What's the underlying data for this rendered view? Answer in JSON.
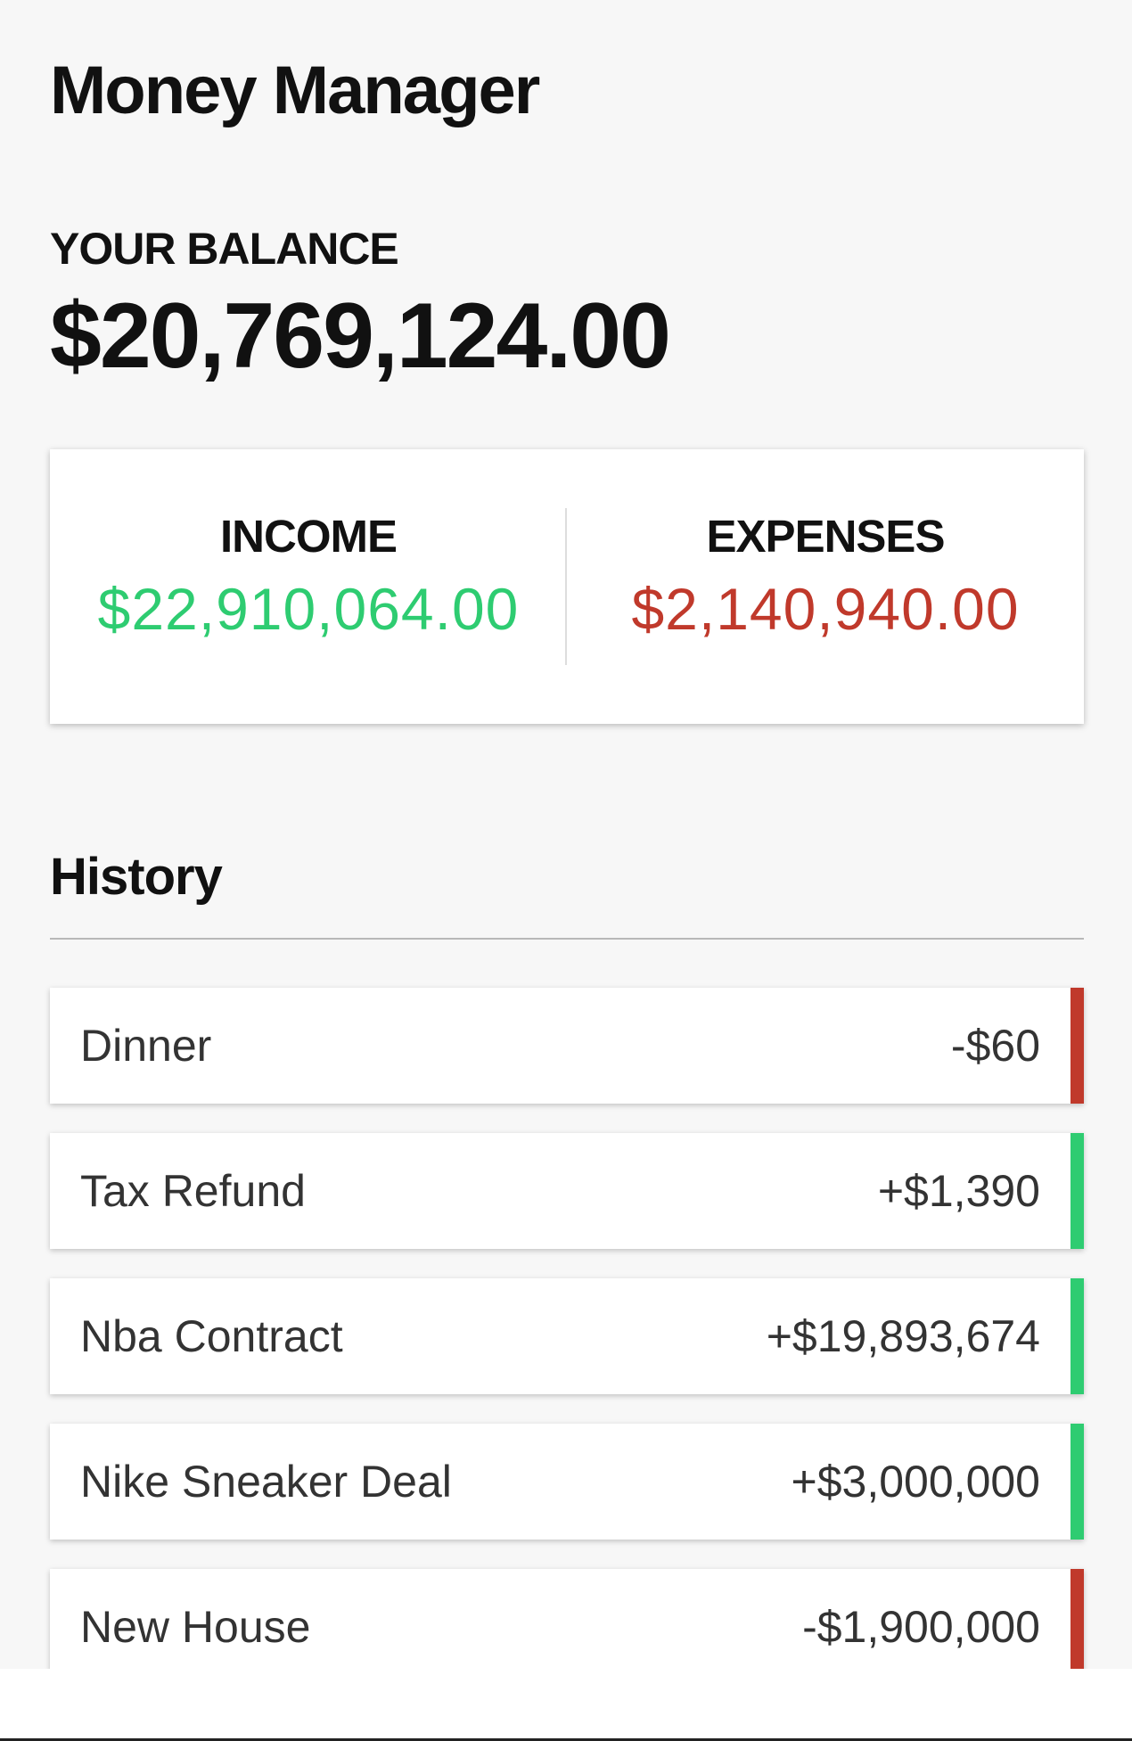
{
  "app": {
    "title": "Money Manager"
  },
  "balance": {
    "label": "YOUR BALANCE",
    "value": "$20,769,124.00"
  },
  "summary": {
    "income_label": "INCOME",
    "income_value": "$22,910,064.00",
    "expenses_label": "EXPENSES",
    "expenses_value": "$2,140,940.00"
  },
  "history": {
    "title": "History",
    "items": [
      {
        "text": "Dinner",
        "amount": "-$60",
        "type": "minus"
      },
      {
        "text": "Tax Refund",
        "amount": "+$1,390",
        "type": "plus"
      },
      {
        "text": "Nba Contract",
        "amount": "+$19,893,674",
        "type": "plus"
      },
      {
        "text": "Nike Sneaker Deal",
        "amount": "+$3,000,000",
        "type": "plus"
      },
      {
        "text": "New House",
        "amount": "-$1,900,000",
        "type": "minus"
      }
    ]
  },
  "colors": {
    "income": "#2ecc71",
    "expense": "#c0392b",
    "background": "#f7f7f7"
  }
}
